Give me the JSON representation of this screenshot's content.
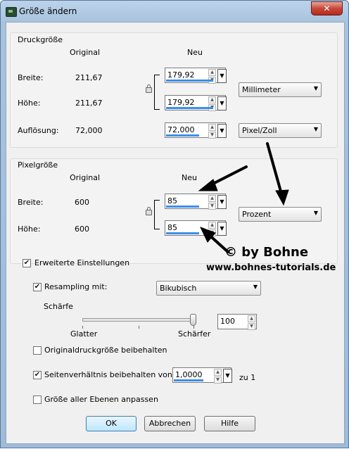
{
  "window": {
    "title": "Größe ändern",
    "close_glyph": "✕"
  },
  "druckgroesse": {
    "title": "Druckgröße",
    "col_original": "Original",
    "col_neu": "Neu",
    "breite_label": "Breite:",
    "breite_original": "211,67",
    "breite_value": "179,92",
    "hoehe_label": "Höhe:",
    "hoehe_original": "211,67",
    "hoehe_value": "179,92",
    "unit": "Millimeter",
    "aufloesung_label": "Auflösung:",
    "aufloesung_original": "72,000",
    "aufloesung_value": "72,000",
    "aufloesung_unit": "Pixel/Zoll"
  },
  "pixelgroesse": {
    "title": "Pixelgröße",
    "col_original": "Original",
    "col_neu": "Neu",
    "breite_label": "Breite:",
    "breite_original": "600",
    "breite_value": "85",
    "hoehe_label": "Höhe:",
    "hoehe_original": "600",
    "hoehe_value": "85",
    "unit": "Prozent"
  },
  "advanced": {
    "erweiterte_label": "Erweiterte Einstellungen",
    "erweiterte_checked": true,
    "resampling_label": "Resampling mit:",
    "resampling_checked": true,
    "resampling_value": "Bikubisch",
    "schaerfe_label": "Schärfe",
    "slider_min_label": "Glatter",
    "slider_max_label": "Schärfer",
    "schaerfe_value": "100",
    "schaerfe_level": 1.0,
    "original_druck_label": "Originaldruckgröße beibehalten",
    "original_druck_checked": false,
    "seitenverhaeltnis_label": "Seitenverhältnis beibehalten von:",
    "seitenverhaeltnis_checked": true,
    "seitenverhaeltnis_value": "1,0000",
    "zu_label": "zu 1",
    "ebenen_label": "Größe aller Ebenen anpassen",
    "ebenen_checked": false
  },
  "buttons": {
    "ok": "OK",
    "abbrechen": "Abbrechen",
    "hilfe": "Hilfe"
  },
  "watermark": {
    "line1": "© by Bohne",
    "line2": "www.bohnes-tutorials.de"
  },
  "colors": {
    "accent_bar": "#3d8ee8",
    "frame": "#9fbbd8",
    "close": "#c9473a"
  }
}
